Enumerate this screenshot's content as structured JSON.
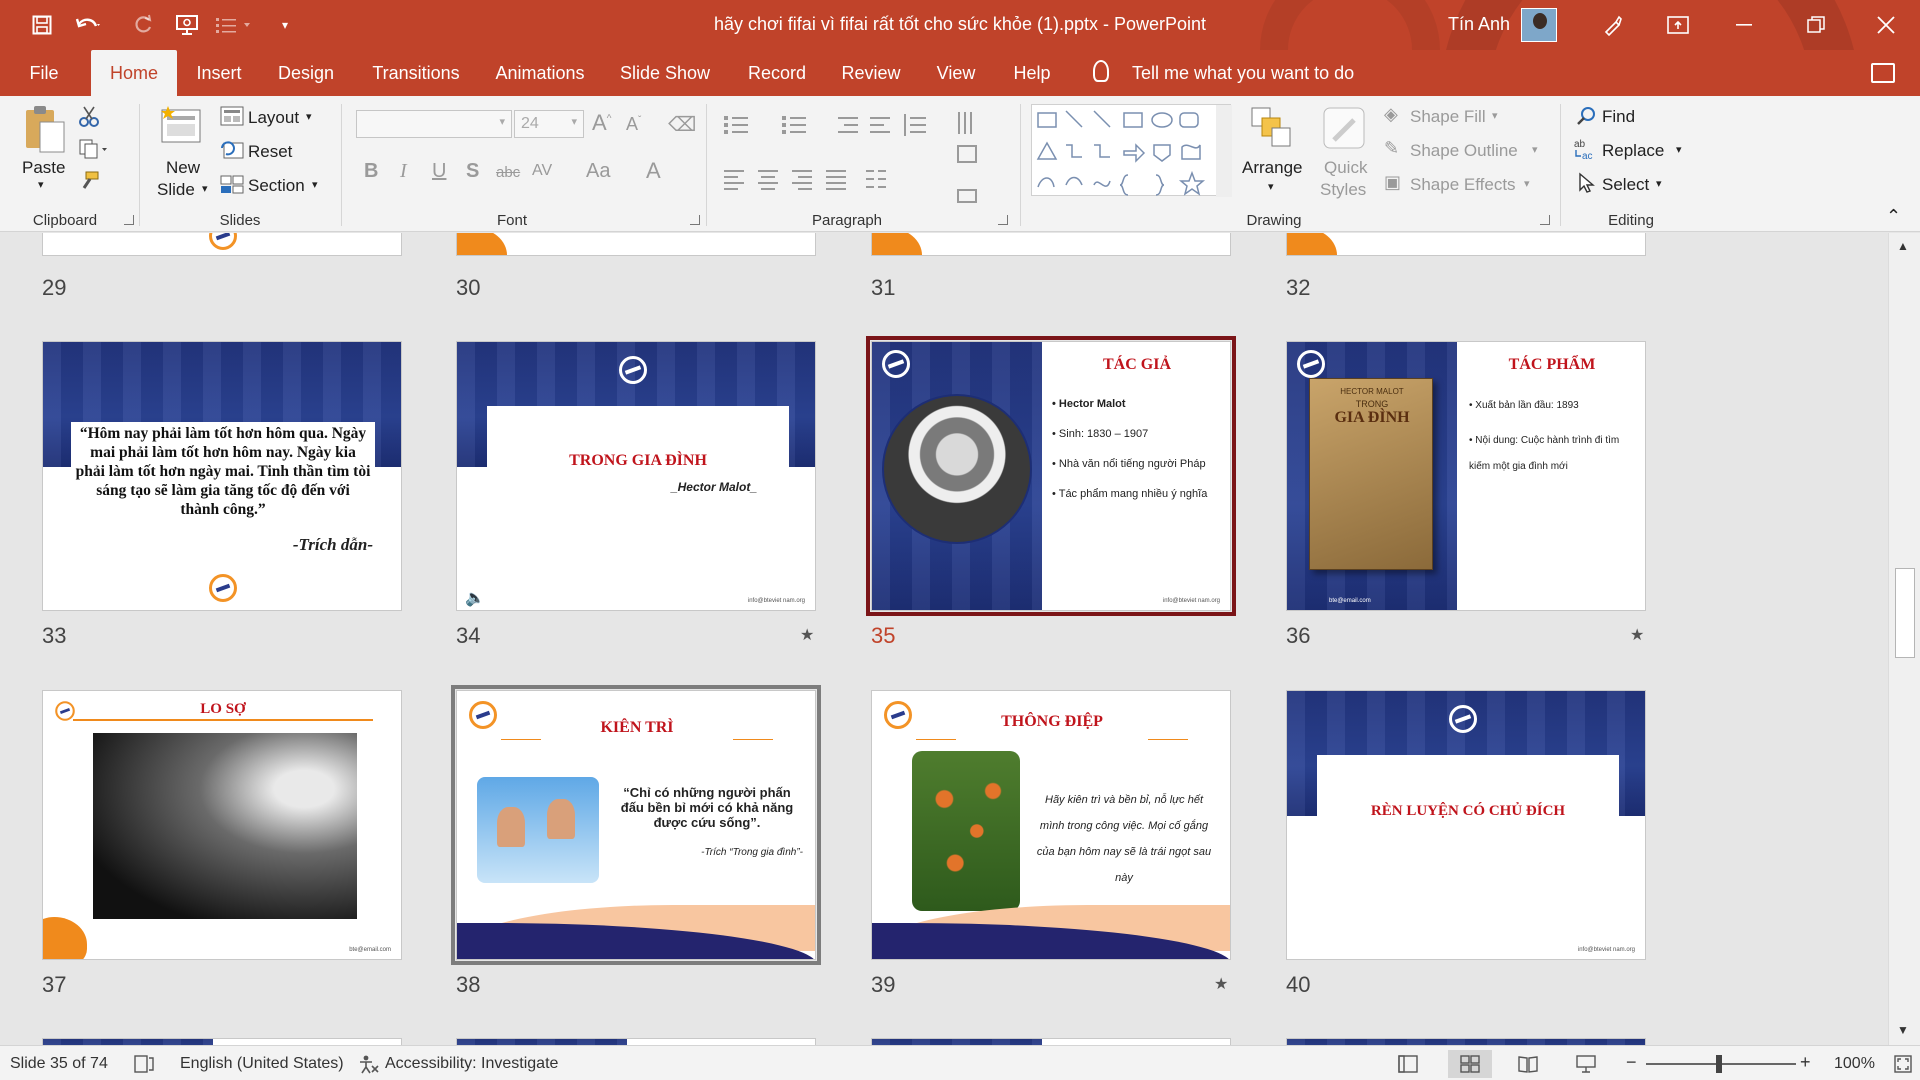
{
  "window": {
    "title": "hãy chơi fifai vì fifai rất tốt cho sức khỏe (1).pptx  -  PowerPoint",
    "user": "Tín Anh",
    "accent": "#c0432a"
  },
  "quick_access": {
    "icons": [
      "save-icon",
      "undo-icon",
      "redo-icon",
      "present-icon",
      "bullets-icon",
      "customize-icon"
    ]
  },
  "tabs": [
    "File",
    "Home",
    "Insert",
    "Design",
    "Transitions",
    "Animations",
    "Slide Show",
    "Record",
    "Review",
    "View",
    "Help"
  ],
  "tell_me": "Tell me what you want to do",
  "ribbon": {
    "clipboard": {
      "paste": "Paste",
      "label": "Clipboard"
    },
    "slides": {
      "new_slide_1": "New",
      "new_slide_2": "Slide",
      "layout": "Layout",
      "reset": "Reset",
      "section": "Section",
      "label": "Slides"
    },
    "font": {
      "size": "24",
      "bold": "B",
      "italic": "I",
      "underline": "U",
      "shadow": "S",
      "strike": "abc",
      "spacing": "AV",
      "case": "Aa",
      "color": "A",
      "label": "Font"
    },
    "paragraph": {
      "label": "Paragraph"
    },
    "drawing": {
      "arrange": "Arrange",
      "quick_styles_1": "Quick",
      "quick_styles_2": "Styles",
      "shape_fill": "Shape Fill",
      "shape_outline": "Shape Outline",
      "shape_effects": "Shape Effects",
      "label": "Drawing"
    },
    "editing": {
      "find": "Find",
      "replace": "Replace",
      "select": "Select",
      "label": "Editing"
    }
  },
  "slides": {
    "row1_nums": [
      "29",
      "30",
      "31",
      "32"
    ],
    "s33": {
      "num": "33",
      "quote": "“Hôm nay phải làm tốt hơn hôm qua. Ngày mai phải làm tốt hơn hôm nay. Ngày kia phải làm tốt hơn ngày mai. Tinh thần tìm tòi sáng tạo sẽ làm gia tăng tốc độ đến với thành công.”",
      "cite": "-Trích dẫn-"
    },
    "s34": {
      "num": "34",
      "title": "TRONG GIA ĐÌNH",
      "author": "_Hector Malot_",
      "email": "info@bteviet nam.org"
    },
    "s35": {
      "num": "35",
      "title": "TÁC GIẢ",
      "bullets": [
        "Hector Malot",
        "Sinh: 1830 – 1907",
        "Nhà văn nổi tiếng người Pháp",
        "Tác phẩm mang nhiều ý nghĩa"
      ],
      "email": "info@bteviet nam.org"
    },
    "s36": {
      "num": "36",
      "title": "TÁC PHẨM",
      "bullets": [
        "Xuất bản lần đầu: 1893",
        "Nội dung: Cuộc hành trình đi tìm kiếm một gia đình mới"
      ],
      "book_top": "HECTOR MALOT",
      "book_mid": "TRONG",
      "book_title": "GIA ĐÌNH",
      "email": "bte@email.com"
    },
    "s37": {
      "num": "37",
      "title": "LO SỢ",
      "email": "bte@email.com"
    },
    "s38": {
      "num": "38",
      "title": "KIÊN TRÌ",
      "quote": "“Chỉ có những người phấn đấu bền bỉ mới có khả năng được cứu sống”.",
      "cite": "-Trích “Trong gia đình”-"
    },
    "s39": {
      "num": "39",
      "title": "THÔNG ĐIỆP",
      "text": "Hãy kiên trì và bền bỉ, nỗ lực hết mình trong công việc. Mọi cố gắng của bạn hôm nay sẽ là trái ngọt sau này"
    },
    "s40": {
      "num": "40",
      "title": "RÈN LUYỆN CÓ CHỦ ĐÍCH",
      "email": "info@bteviet nam.org"
    }
  },
  "status": {
    "slide_count": "Slide 35 of 74",
    "language": "English (United States)",
    "accessibility": "Accessibility: Investigate",
    "zoom": "100%"
  }
}
